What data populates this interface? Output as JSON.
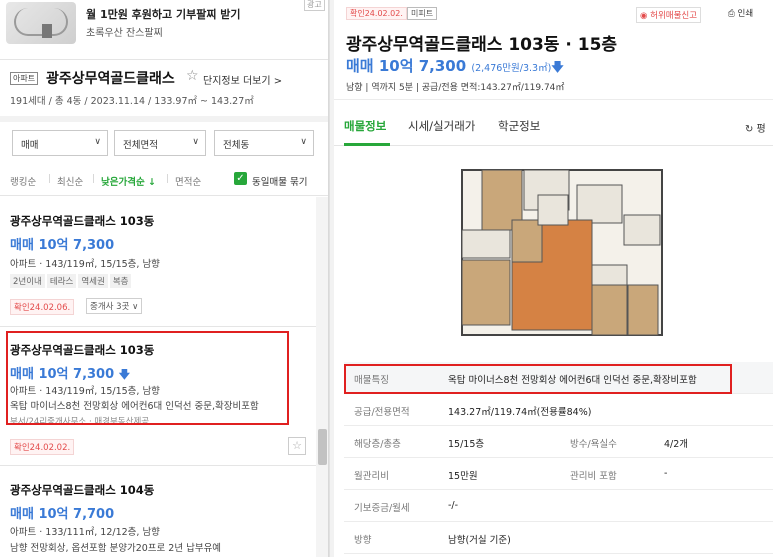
{
  "ad": {
    "title": "월 1만원 후원하고 기부팔찌 받기",
    "subtitle": "초록우산 잔스팔찌",
    "badge": "광고"
  },
  "complex": {
    "type_tag": "아파트",
    "name": "광주상무역골드클래스",
    "star": "☆",
    "link": "단지정보 더보기 >",
    "meta": "191세대 / 총 4동 / 2023.11.14 / 133.97㎡ ~ 143.27㎡"
  },
  "filters": {
    "trade": "매매",
    "area": "전체면적",
    "dong": "전체동"
  },
  "sort": {
    "items": [
      "랭킹순",
      "최신순",
      "낮은가격순 ↓",
      "면적순"
    ],
    "checkbox_label": "동일매물 묶기"
  },
  "listings": [
    {
      "name": "광주상무역골드클래스 103동",
      "price": "매매 10억 7,300",
      "price_arrow": "",
      "detail": "아파트 · 143/119㎡, 15/15층, 남향",
      "tags": [
        "2년이내",
        "테라스",
        "역세권",
        "복층"
      ],
      "confirm": "확인24.02.06.",
      "agent": "중개사 3곳 ∨"
    },
    {
      "name": "광주상무역골드클래스 103동",
      "price": "매매 10억 7,300",
      "price_arrow": "🡇",
      "detail": "아파트 · 143/119㎡, 15/15층, 남향",
      "desc": "옥탑 마이너스8천 전망회상 에어컨6대 인덕선 중문,확장비포함",
      "desc2": "부서/24리중개사무소 · 매경부동산제공",
      "confirm": "확인24.02.02."
    },
    {
      "name": "광주상무역골드클래스 104동",
      "price": "매매 10억 7,700",
      "detail": "아파트 · 133/111㎡, 12/12층, 남향",
      "desc": "남향 전망회상, 옵션포함 분양가20프로 2년 납부유예"
    }
  ],
  "detail": {
    "confirm": "확인24.02.02.",
    "tag": "미피트",
    "report": "허위매물신고",
    "print": "인쇄",
    "title": "광주상무역골드클래스 103동 · 15층",
    "price": "매매 10억 7,300",
    "price_sub": "(2,476만원/3.3㎡)",
    "price_arrow": "🡇",
    "meta": "남향 | 역까지 5분 | 공급/전용 면적:143.27㎡/119.74㎡",
    "tabs": [
      "매물정보",
      "시세/실거래가",
      "학군정보"
    ],
    "tab_right": "↻ 평",
    "rows": [
      {
        "k": "매물특징",
        "v": "옥탑 마이너스8천 전망회상 에어컨6대 인덕선 중문,확장비포함"
      },
      {
        "k": "공급/전용면적",
        "v": "143.27㎡/119.74㎡(전용률84%)"
      },
      {
        "k": "해당층/총층",
        "v": "15/15층",
        "k2": "방수/욕실수",
        "v2": "4/2개"
      },
      {
        "k": "월관리비",
        "v": "15만원",
        "k2": "관리비 포함",
        "v2": "-"
      },
      {
        "k": "기보증금/월세",
        "v": "-/-"
      },
      {
        "k": "방향",
        "v": "남향(거실 기준)"
      }
    ]
  },
  "colors": {
    "accent_green": "#27a73a",
    "price_blue": "#3a7ad6",
    "highlight_red": "#e02020"
  }
}
